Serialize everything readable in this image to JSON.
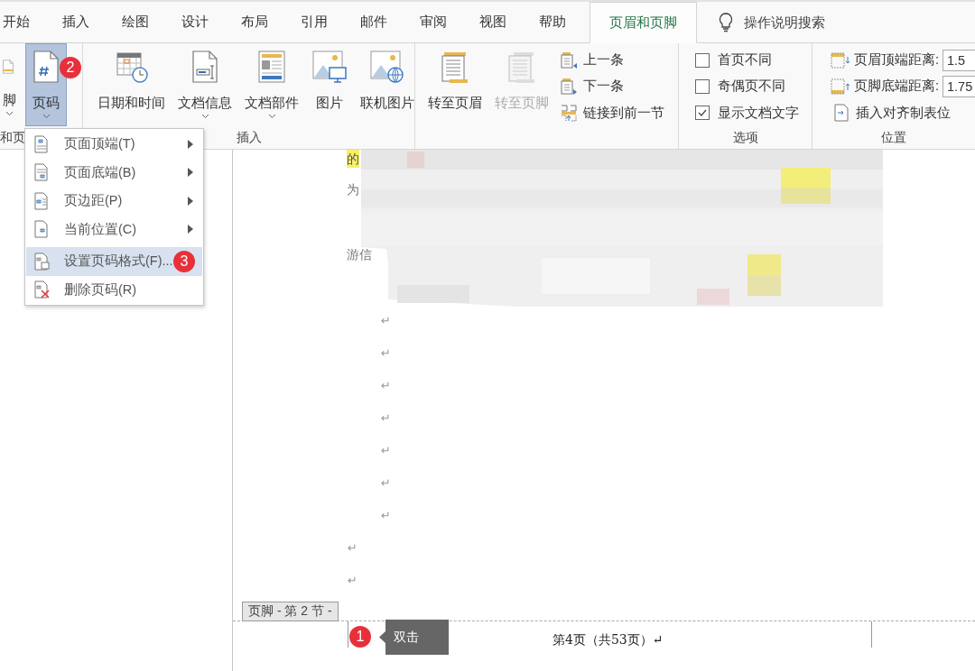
{
  "tabs": [
    {
      "label": "开始",
      "selected": false
    },
    {
      "label": "插入",
      "selected": false
    },
    {
      "label": "绘图",
      "selected": false
    },
    {
      "label": "设计",
      "selected": false
    },
    {
      "label": "布局",
      "selected": false
    },
    {
      "label": "引用",
      "selected": false
    },
    {
      "label": "邮件",
      "selected": false
    },
    {
      "label": "审阅",
      "selected": false
    },
    {
      "label": "视图",
      "selected": false
    },
    {
      "label": "帮助",
      "selected": false
    },
    {
      "label": "页眉和页脚",
      "selected": true
    }
  ],
  "tell_me": {
    "placeholder": "操作说明搜索"
  },
  "ribbon": {
    "groups": [
      {
        "kind": "large_buttons",
        "label": "和页",
        "buttons": [
          {
            "label": "脚",
            "selected": false,
            "dropdown": true
          },
          {
            "label": "页码",
            "selected": true,
            "dropdown": true,
            "badge": "2"
          }
        ]
      },
      {
        "kind": "large_buttons",
        "label": "插入",
        "buttons": [
          {
            "label": "日期和时间",
            "selected": false,
            "dropdown": false
          },
          {
            "label": "文档信息",
            "selected": false,
            "dropdown": true
          },
          {
            "label": "文档部件",
            "selected": false,
            "dropdown": true
          },
          {
            "label": "图片",
            "selected": false,
            "dropdown": false
          },
          {
            "label": "联机图片",
            "selected": false,
            "dropdown": false
          }
        ]
      },
      {
        "kind": "navigation",
        "buttons": [
          {
            "label": "转至页眉",
            "disabled": false
          },
          {
            "label": "转至页脚",
            "disabled": true
          }
        ],
        "small_buttons": [
          "上一条",
          "下一条",
          "链接到前一节"
        ]
      },
      {
        "kind": "checkboxes",
        "label": "选项",
        "checkboxes": [
          {
            "label": "首页不同",
            "checked": false
          },
          {
            "label": "奇偶页不同",
            "checked": false
          },
          {
            "label": "显示文档文字",
            "checked": true
          }
        ]
      },
      {
        "kind": "position",
        "label": "位置",
        "fields": [
          {
            "label": "页眉顶端距离:",
            "value": "1.5"
          },
          {
            "label": "页脚底端距离:",
            "value": "1.75"
          }
        ],
        "button": "插入对齐制表位"
      }
    ]
  },
  "menu": {
    "items": [
      {
        "label": "页面顶端(T)",
        "submenu": true,
        "selected": false
      },
      {
        "label": "页面底端(B)",
        "submenu": true,
        "selected": false
      },
      {
        "label": "页边距(P)",
        "submenu": true,
        "selected": false
      },
      {
        "label": "当前位置(C)",
        "submenu": true,
        "selected": false
      },
      {
        "label": "设置页码格式(F)...",
        "submenu": false,
        "selected": true,
        "badge": "3"
      },
      {
        "label": "删除页码(R)",
        "submenu": false,
        "selected": false
      }
    ]
  },
  "document": {
    "lines": [
      {
        "text": "的",
        "highlight": true
      },
      {
        "text": "为",
        "highlight": false
      },
      {
        "text": "游信",
        "highlight": false
      }
    ],
    "paragraph_marks": [
      {
        "text": "↵",
        "kind": "indented"
      },
      {
        "text": "↵",
        "kind": "indented"
      },
      {
        "text": "↵",
        "kind": "indented"
      },
      {
        "text": "↵",
        "kind": "indented"
      },
      {
        "text": "↵",
        "kind": "indented"
      },
      {
        "text": "↵",
        "kind": "indented"
      },
      {
        "text": "↵",
        "kind": "indented"
      },
      {
        "text": "↵",
        "kind": "plain"
      },
      {
        "text": "↵",
        "kind": "plain"
      }
    ]
  },
  "footer": {
    "label": "页脚 - 第 2 节 -",
    "tooltip": {
      "text": "双击",
      "badge": "1"
    },
    "text": "第4页（共53页）↵"
  }
}
